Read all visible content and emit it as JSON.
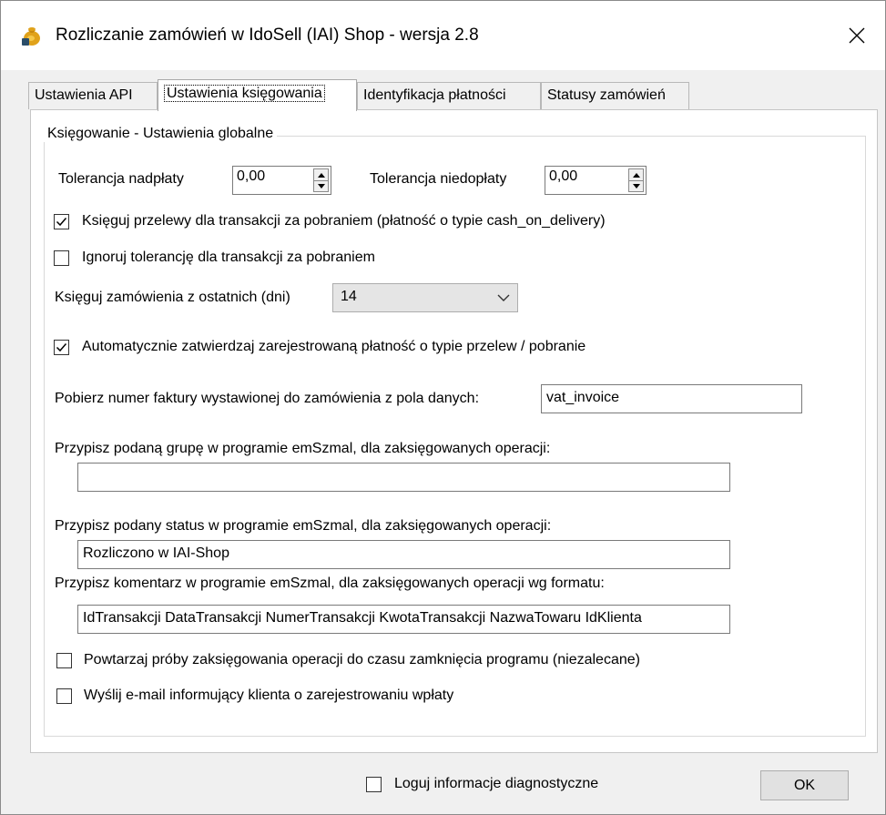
{
  "window": {
    "title": "Rozliczanie zamówień w IdoSell (IAI) Shop - wersja 2.8"
  },
  "tabs": [
    {
      "label": "Ustawienia API"
    },
    {
      "label": "Ustawienia księgowania"
    },
    {
      "label": "Identyfikacja płatności"
    },
    {
      "label": "Statusy zamówień"
    }
  ],
  "group": {
    "legend": "Księgowanie - Ustawienia globalne",
    "overpay_label": "Tolerancja nadpłaty",
    "overpay_value": "0,00",
    "underpay_label": "Tolerancja niedopłaty",
    "underpay_value": "0,00",
    "cod_transfers_label": "Księguj przelewy dla transakcji za pobraniem (płatność o typie cash_on_delivery)",
    "cod_transfers_checked": true,
    "ignore_tolerance_label": "Ignoruj tolerancję dla transakcji za pobraniem",
    "ignore_tolerance_checked": false,
    "days_label": "Księguj zamówienia z ostatnich (dni)",
    "days_value": "14",
    "auto_confirm_label": "Automatycznie zatwierdzaj zarejestrowaną płatność o typie przelew / pobranie",
    "auto_confirm_checked": true,
    "invoice_field_label": "Pobierz numer faktury wystawionej do zamówienia z pola danych:",
    "invoice_field_value": "vat_invoice",
    "group_label": "Przypisz podaną grupę w programie emSzmal, dla zaksięgowanych operacji:",
    "group_value": "",
    "status_label": "Przypisz podany status w programie emSzmal, dla zaksięgowanych operacji:",
    "status_value": "Rozliczono w IAI-Shop",
    "comment_label": "Przypisz komentarz w programie emSzmal, dla zaksięgowanych operacji wg formatu:",
    "comment_value": "IdTransakcji DataTransakcji NumerTransakcji KwotaTransakcji NazwaTowaru IdKlienta",
    "retry_label": "Powtarzaj próby zaksięgowania operacji do czasu zamknięcia programu (niezalecane)",
    "retry_checked": false,
    "email_label": "Wyślij e-mail informujący klienta o zarejestrowaniu wpłaty",
    "email_checked": false
  },
  "footer": {
    "diagnostics_label": "Loguj informacje diagnostyczne",
    "diagnostics_checked": false,
    "ok_label": "OK"
  }
}
